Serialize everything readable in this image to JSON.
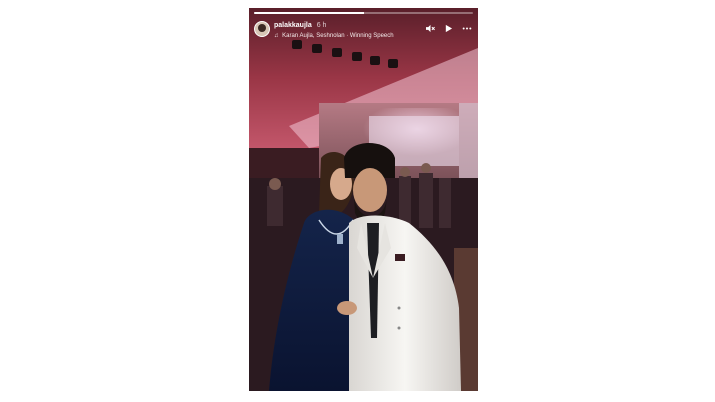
{
  "story": {
    "username": "palakkaujla",
    "time": "6 h",
    "music": "Karan Aujla, Seshnolan · Winning Speech",
    "progress": 0.5
  },
  "icons": {
    "music": "music-note-icon",
    "mute": "speaker-muted-icon",
    "play": "play-icon",
    "more": "more-options-icon"
  },
  "colors": {
    "header_text": "#ffffff",
    "ceiling": "#8a2a3a",
    "dress": "#0f1e3d",
    "blazer": "#f2f1ee"
  }
}
